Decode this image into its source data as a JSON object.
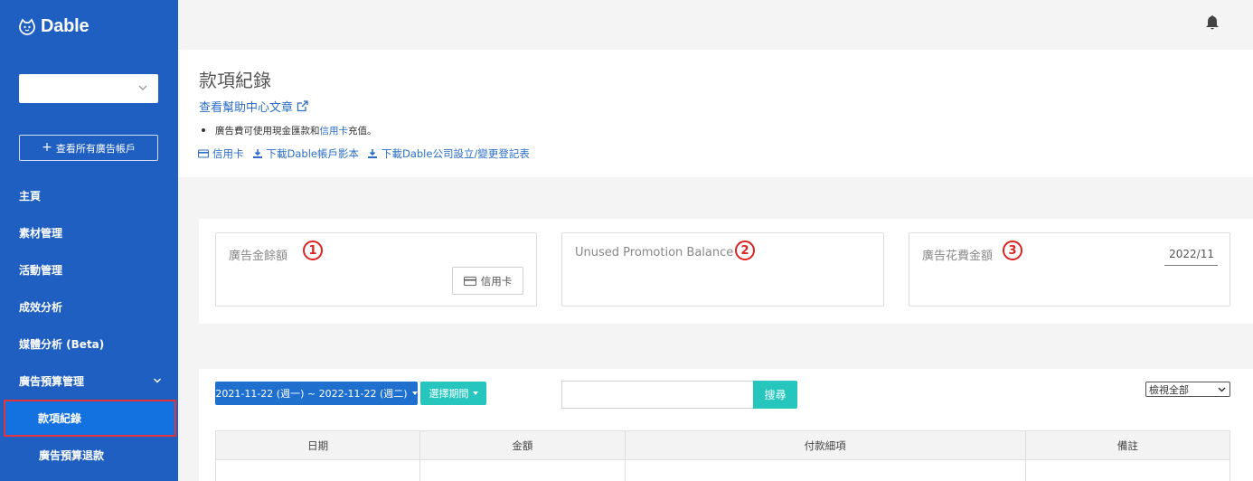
{
  "brand": {
    "name": "Dable"
  },
  "sidebar": {
    "account_select_value": "",
    "all_accounts_button": "查看所有廣告帳戶",
    "menu": [
      {
        "label": "主頁"
      },
      {
        "label": "素材管理"
      },
      {
        "label": "活動管理"
      },
      {
        "label": "成效分析"
      },
      {
        "label": "媒體分析 (Beta)"
      },
      {
        "label": "廣告預算管理"
      }
    ],
    "submenu": [
      {
        "label": "款項紀錄",
        "active": true
      },
      {
        "label": "廣告預算退款"
      }
    ]
  },
  "header": {
    "title": "款項紀錄",
    "help_link": "查看幫助中心文章",
    "note_prefix": "廣告費可使用現金匯款和",
    "note_highlight": "信用卡",
    "note_suffix": "充值。",
    "links": [
      {
        "label": "信用卡",
        "icon": "credit-card-icon"
      },
      {
        "label": "下載Dable帳戶影本",
        "icon": "download-icon"
      },
      {
        "label": "下載Dable公司設立/變更登記表",
        "icon": "download-icon"
      }
    ]
  },
  "balance": {
    "cards": [
      {
        "label": "廣告金餘額",
        "marker": "1",
        "button": "信用卡"
      },
      {
        "label": "Unused Promotion Balance",
        "marker": "2"
      },
      {
        "label": "廣告花費金額",
        "marker": "3",
        "month": "2022/11"
      }
    ]
  },
  "records": {
    "date_range": "2021-11-22 (週一) ~ 2022-11-22 (週二)",
    "period_button": "選擇期間",
    "search_value": "",
    "search_button": "搜尋",
    "view_select": "檢視全部",
    "columns": [
      "日期",
      "金額",
      "付款細項",
      "備註"
    ]
  },
  "colors": {
    "sidebar": "#1f5fc2",
    "primary_button": "#1f6fcf",
    "accent": "#26c6be",
    "link": "#2a6ec8",
    "highlight_border": "#e0333a"
  }
}
